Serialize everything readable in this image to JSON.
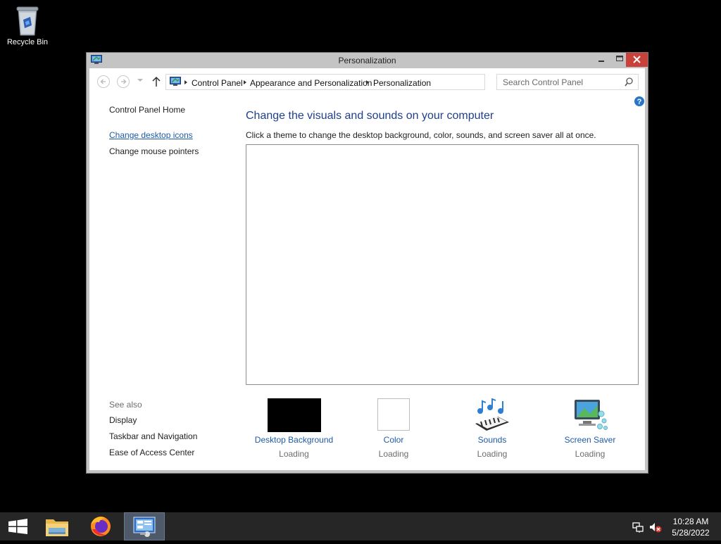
{
  "desktop": {
    "icons": [
      {
        "label": "Recycle Bin",
        "icon": "recycle-bin-icon"
      }
    ]
  },
  "window": {
    "title": "Personalization",
    "controls": {
      "minimize": "minimize",
      "maximize": "maximize",
      "close": "close"
    }
  },
  "address_bar": {
    "breadcrumbs": [
      "Control Panel",
      "Appearance and Personalization",
      "Personalization"
    ]
  },
  "search": {
    "placeholder": "Search Control Panel"
  },
  "left_pane": {
    "links": [
      {
        "label": "Control Panel Home"
      },
      {
        "label": "Change desktop icons",
        "active": true
      },
      {
        "label": "Change mouse pointers"
      }
    ],
    "see_also_heading": "See also",
    "see_also": [
      "Display",
      "Taskbar and Navigation",
      "Ease of Access Center"
    ]
  },
  "main": {
    "heading": "Change the visuals and sounds on your computer",
    "description": "Click a theme to change the desktop background, color, sounds, and screen saver all at once.",
    "tiles": [
      {
        "label": "Desktop Background",
        "status": "Loading"
      },
      {
        "label": "Color",
        "status": "Loading"
      },
      {
        "label": "Sounds",
        "status": "Loading"
      },
      {
        "label": "Screen Saver",
        "status": "Loading"
      }
    ]
  },
  "taskbar": {
    "items": [
      "start-button",
      "file-explorer",
      "firefox",
      "control-panel"
    ],
    "clock": {
      "time": "10:28 AM",
      "date": "5/28/2022"
    }
  },
  "colors": {
    "link": "#1e5aa8",
    "heading": "#1e3f8a",
    "close_button": "#c8413a",
    "titlebar": "#c4c4c4",
    "taskbar": "#262626"
  }
}
